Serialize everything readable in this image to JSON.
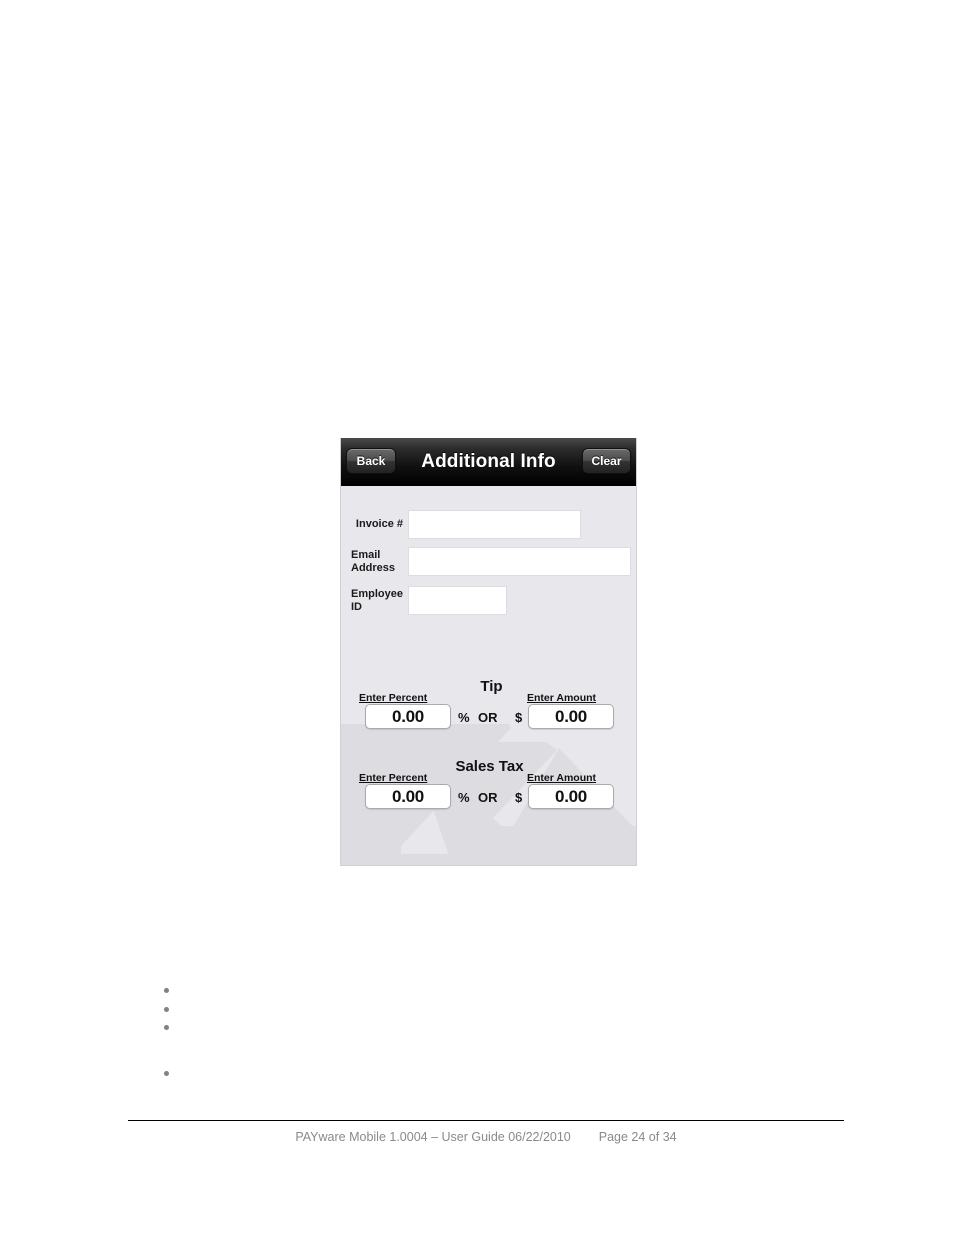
{
  "app_screenshot": {
    "titlebar": {
      "back_label": "Back",
      "title": "Additional Info",
      "clear_label": "Clear"
    },
    "fields": [
      {
        "label": "Invoice #",
        "value": "",
        "placeholder": ""
      },
      {
        "label": "Email\nAddress",
        "label_line1": "Email",
        "label_line2": "Address",
        "value": "",
        "placeholder": ""
      },
      {
        "label": "Employee ID",
        "label_line1": "Employee",
        "label_line2": "ID",
        "value": "",
        "placeholder": ""
      }
    ],
    "tip": {
      "title": "Tip",
      "percent_label": "Enter Percent",
      "percent_value": "0.00",
      "percent_sign": "%",
      "or_text": "OR",
      "currency_sign": "$",
      "amount_label": "Enter Amount",
      "amount_value": "0.00"
    },
    "sales_tax": {
      "title": "Sales Tax",
      "percent_label": "Enter Percent",
      "percent_value": "0.00",
      "percent_sign": "%",
      "or_text": "OR",
      "currency_sign": "$",
      "amount_label": "Enter Amount",
      "amount_value": "0.00"
    },
    "colors": {
      "screen_background": "#e8e8ec",
      "titlebar_dark": "#000000",
      "input_white": "#ffffff",
      "watermark": "#dddde1"
    }
  },
  "document": {
    "bullets": [
      "",
      "",
      "",
      ""
    ],
    "footer": {
      "product_line": "PAYware Mobile 1.0004 – User Guide 06/22/2010",
      "page_number": "Page 24 of 34"
    }
  }
}
